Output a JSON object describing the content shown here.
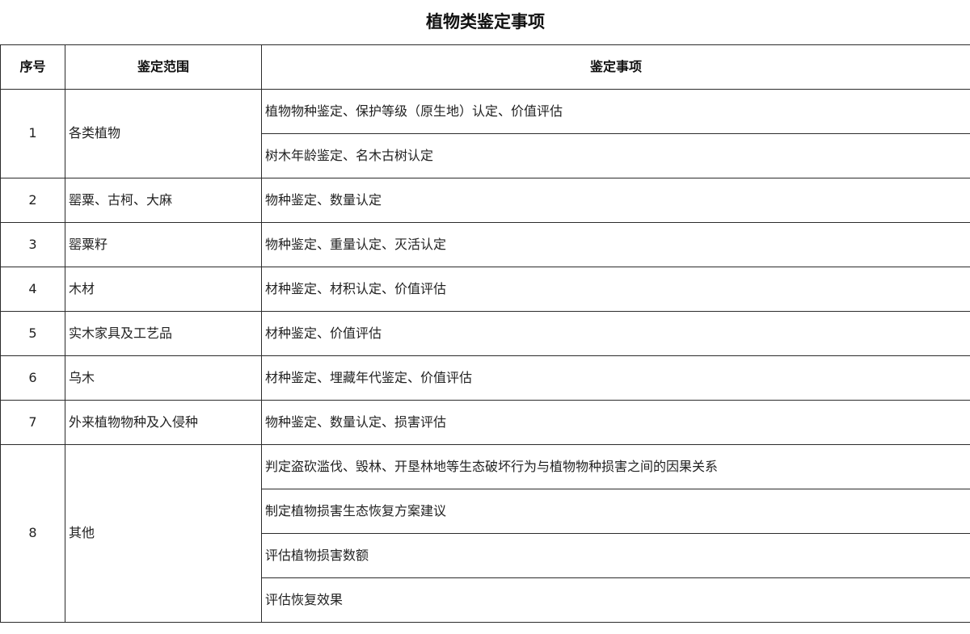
{
  "title": "植物类鉴定事项",
  "headers": {
    "index": "序号",
    "scope": "鉴定范围",
    "items": "鉴定事项"
  },
  "rows": [
    {
      "index": "1",
      "scope": "各类植物",
      "items": [
        "植物物种鉴定、保护等级（原生地）认定、价值评估",
        "树木年龄鉴定、名木古树认定"
      ]
    },
    {
      "index": "2",
      "scope": "罂粟、古柯、大麻",
      "items": [
        "物种鉴定、数量认定"
      ]
    },
    {
      "index": "3",
      "scope": "罂粟籽",
      "items": [
        "物种鉴定、重量认定、灭活认定"
      ]
    },
    {
      "index": "4",
      "scope": "木材",
      "items": [
        "材种鉴定、材积认定、价值评估"
      ]
    },
    {
      "index": "5",
      "scope": "实木家具及工艺品",
      "items": [
        "材种鉴定、价值评估"
      ]
    },
    {
      "index": "6",
      "scope": "乌木",
      "items": [
        "材种鉴定、埋藏年代鉴定、价值评估"
      ]
    },
    {
      "index": "7",
      "scope": "外来植物物种及入侵种",
      "items": [
        "物种鉴定、数量认定、损害评估"
      ]
    },
    {
      "index": "8",
      "scope": "其他",
      "items": [
        "判定盗砍滥伐、毁林、开垦林地等生态破坏行为与植物物种损害之间的因果关系",
        "制定植物损害生态恢复方案建议",
        "评估植物损害数额",
        "评估恢复效果"
      ]
    }
  ]
}
